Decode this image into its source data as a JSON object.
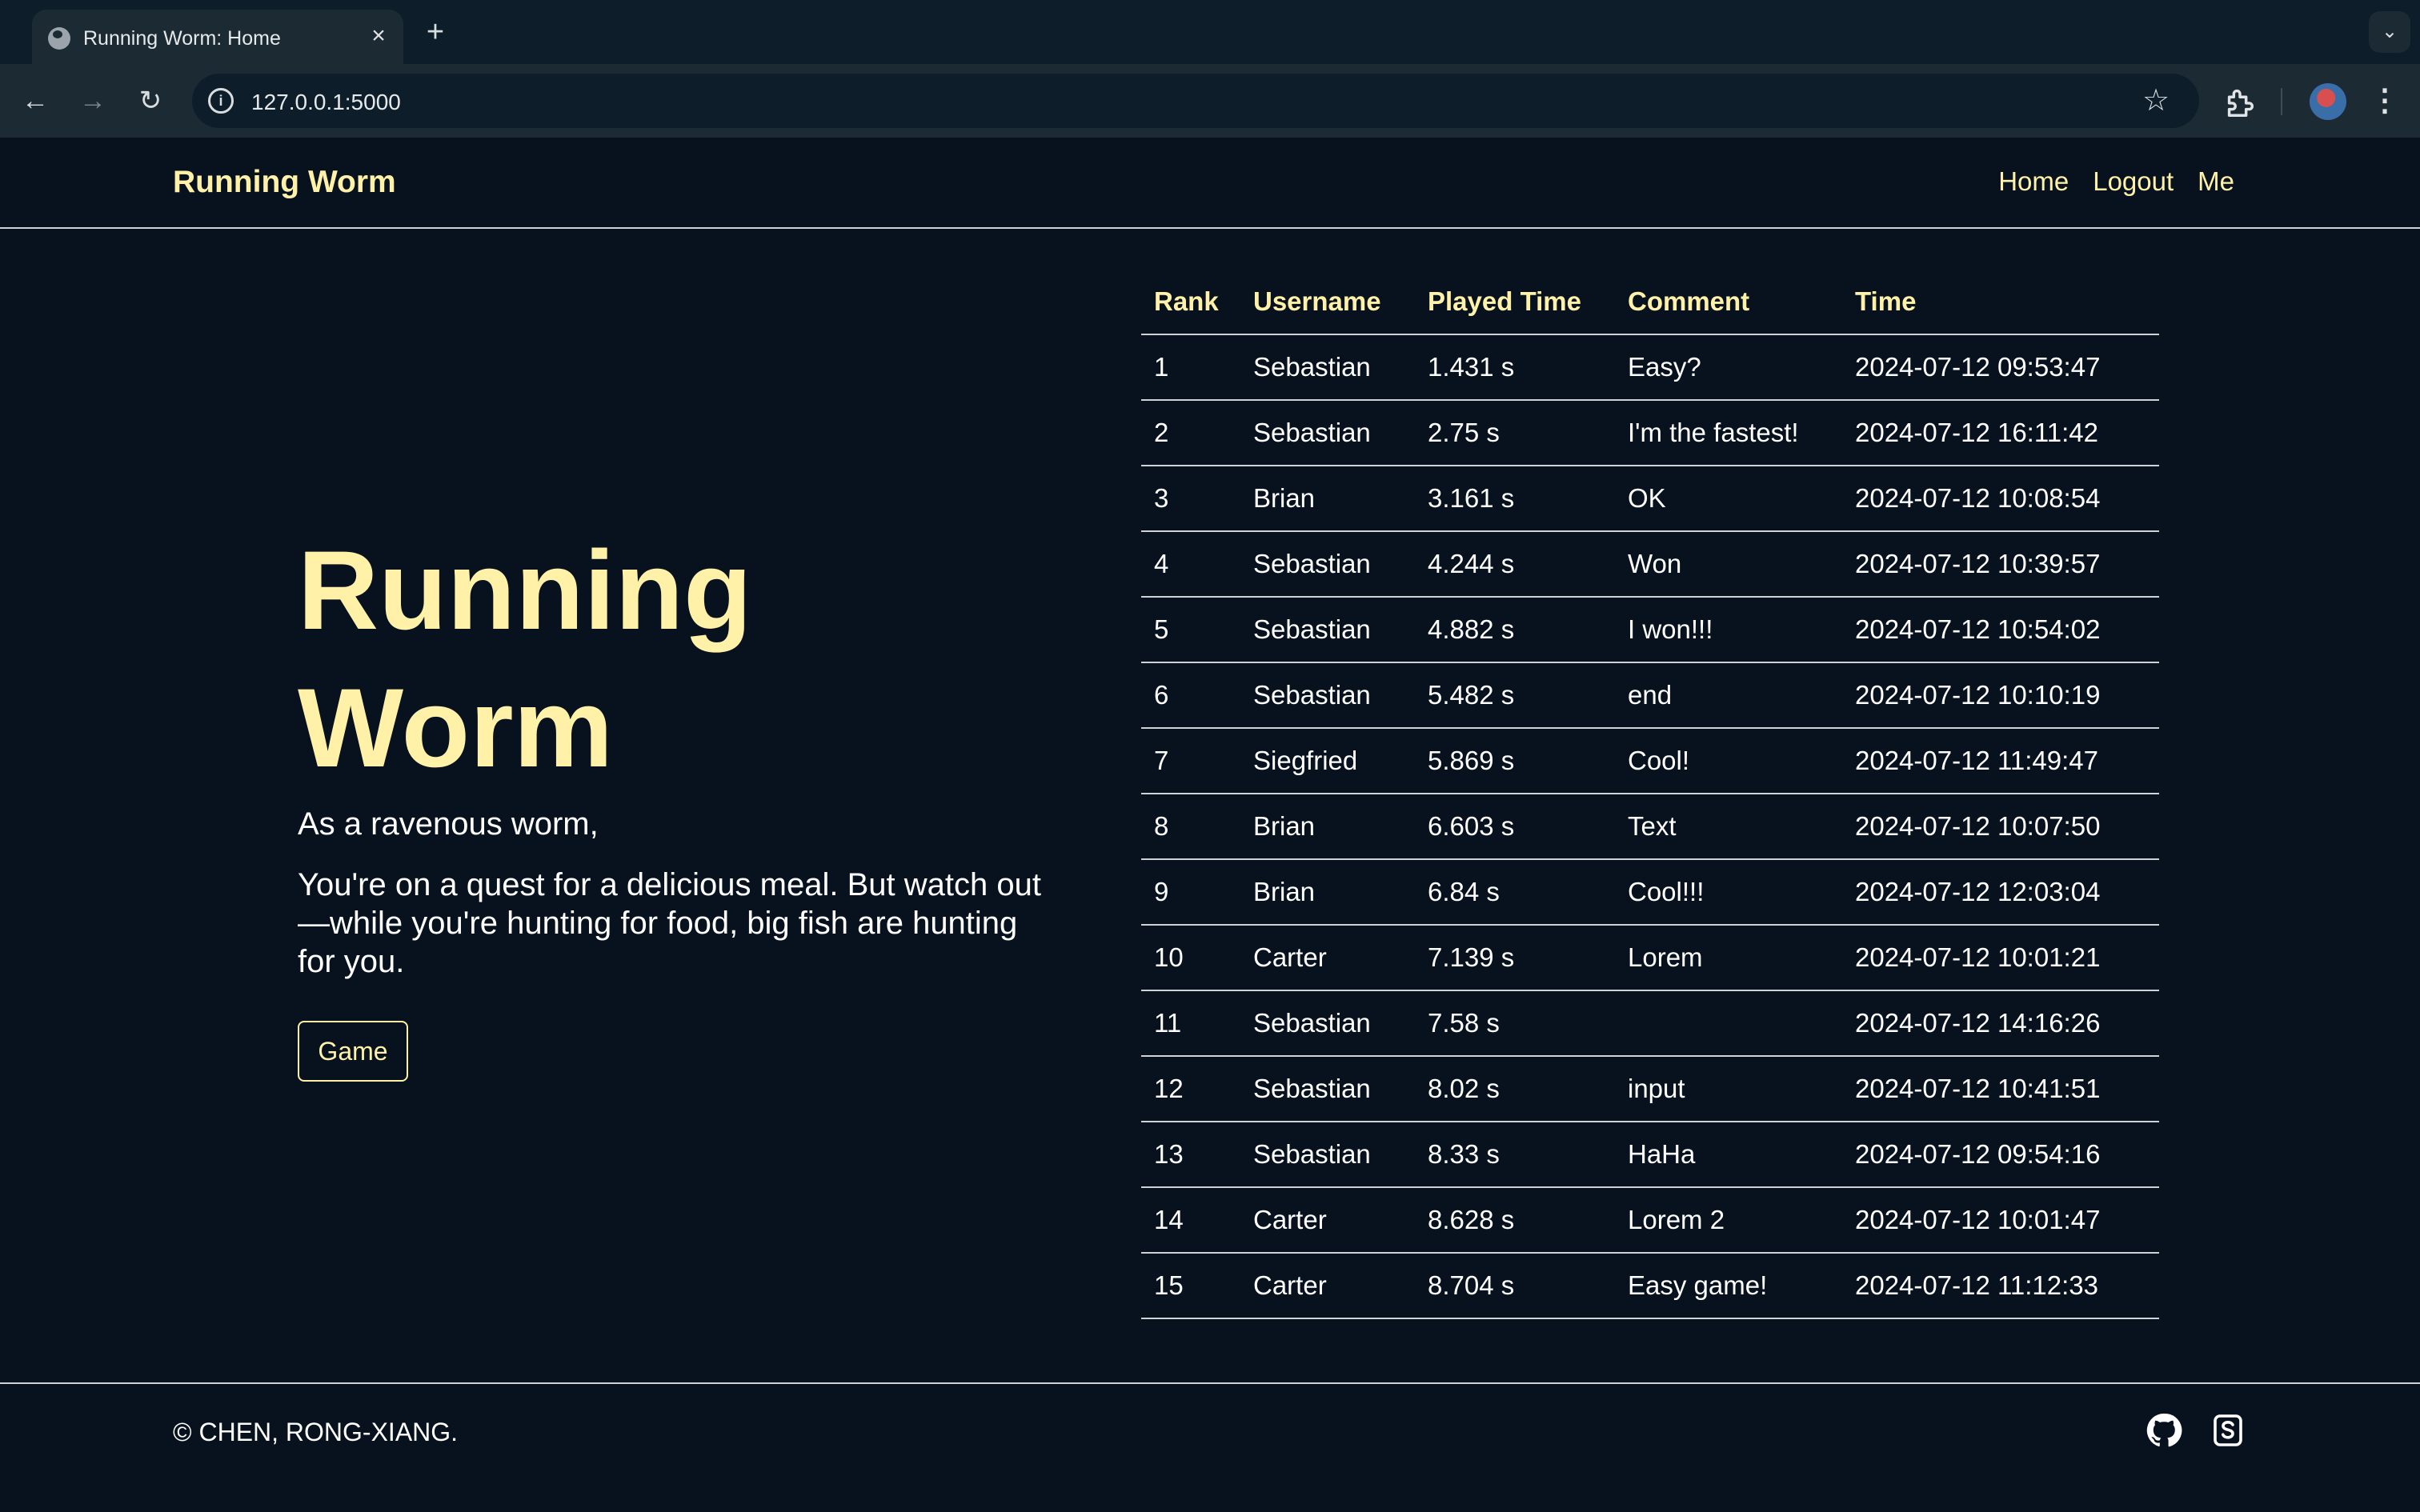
{
  "browser": {
    "tab_title": "Running Worm: Home",
    "url": "127.0.0.1:5000",
    "tab_close": "×",
    "new_tab": "+",
    "tab_search": "⌄",
    "back": "←",
    "forward": "→",
    "reload": "↻",
    "star": "☆",
    "menu": "⋮",
    "info": "i"
  },
  "header": {
    "brand": "Running Worm",
    "nav": [
      "Home",
      "Logout",
      "Me"
    ]
  },
  "hero": {
    "title": "Running Worm",
    "line1": "As a ravenous worm,",
    "paragraph": "You're on a quest for a delicious meal. But watch out—while you're hunting for food, big fish are hunting for you.",
    "button": "Game"
  },
  "leaderboard": {
    "columns": [
      "Rank",
      "Username",
      "Played Time",
      "Comment",
      "Time"
    ],
    "rows": [
      [
        "1",
        "Sebastian",
        "1.431 s",
        "Easy?",
        "2024-07-12 09:53:47"
      ],
      [
        "2",
        "Sebastian",
        "2.75 s",
        "I'm the fastest!",
        "2024-07-12 16:11:42"
      ],
      [
        "3",
        "Brian",
        "3.161 s",
        "OK",
        "2024-07-12 10:08:54"
      ],
      [
        "4",
        "Sebastian",
        "4.244 s",
        "Won",
        "2024-07-12 10:39:57"
      ],
      [
        "5",
        "Sebastian",
        "4.882 s",
        "I won!!!",
        "2024-07-12 10:54:02"
      ],
      [
        "6",
        "Sebastian",
        "5.482 s",
        "end",
        "2024-07-12 10:10:19"
      ],
      [
        "7",
        "Siegfried",
        "5.869 s",
        "Cool!",
        "2024-07-12 11:49:47"
      ],
      [
        "8",
        "Brian",
        "6.603 s",
        "Text",
        "2024-07-12 10:07:50"
      ],
      [
        "9",
        "Brian",
        "6.84 s",
        "Cool!!!",
        "2024-07-12 12:03:04"
      ],
      [
        "10",
        "Carter",
        "7.139 s",
        "Lorem",
        "2024-07-12 10:01:21"
      ],
      [
        "11",
        "Sebastian",
        "7.58 s",
        "",
        "2024-07-12 14:16:26"
      ],
      [
        "12",
        "Sebastian",
        "8.02 s",
        "input",
        "2024-07-12 10:41:51"
      ],
      [
        "13",
        "Sebastian",
        "8.33 s",
        "HaHa",
        "2024-07-12 09:54:16"
      ],
      [
        "14",
        "Carter",
        "8.628 s",
        "Lorem 2",
        "2024-07-12 10:01:47"
      ],
      [
        "15",
        "Carter",
        "8.704 s",
        "Easy game!",
        "2024-07-12 11:12:33"
      ]
    ]
  },
  "footer": {
    "copyright": "© CHEN, RONG-XIANG.",
    "icons": [
      "github-icon",
      "stack-icon"
    ]
  },
  "colors": {
    "background": "#08121f",
    "accent": "#fff2a8",
    "text": "#ffffff"
  }
}
